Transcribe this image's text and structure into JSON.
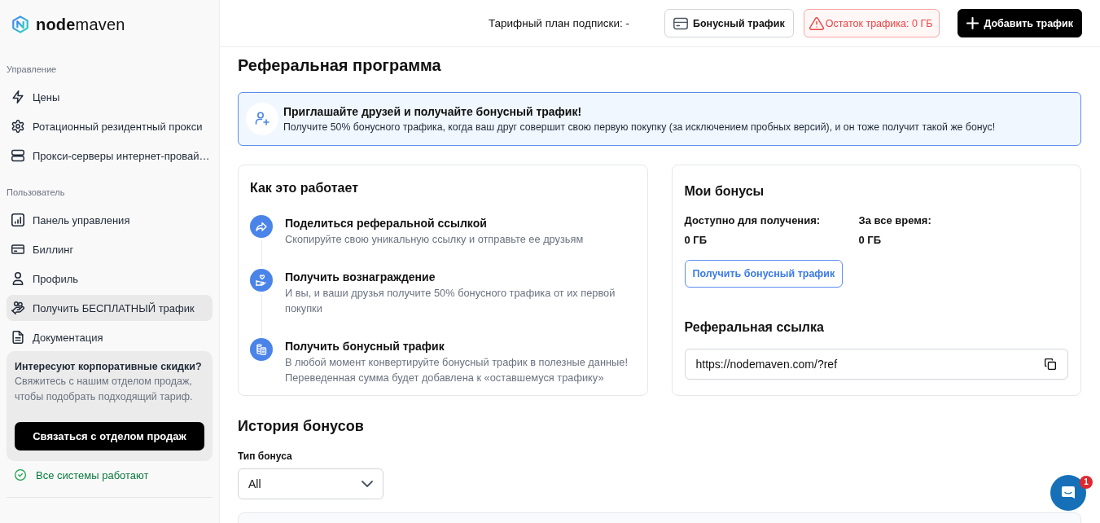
{
  "sidebar": {
    "logo": "**node**maven",
    "sections": [
      {
        "title": "Управление",
        "items": [
          {
            "label": "Цены",
            "selected": false
          },
          {
            "label": "Ротационный резидентный прокси",
            "selected": false
          },
          {
            "label": "Прокси-серверы интернет-провай…",
            "selected": false
          }
        ]
      },
      {
        "title": "Пользователь",
        "items": [
          {
            "label": "Панель управления",
            "selected": false
          },
          {
            "label": "Биллинг",
            "selected": false
          },
          {
            "label": "Профиль",
            "selected": false
          },
          {
            "label": "Получить БЕСПЛАТНЫЙ трафик",
            "selected": true
          },
          {
            "label": "Документация",
            "selected": false
          }
        ]
      }
    ],
    "promo": {
      "title": "Интересуют корпоративные скидки?",
      "text": "Свяжитесь с нашим отделом продаж, чтобы подобрать подходящий тариф.",
      "button": "Связаться с отделом продаж"
    },
    "status": {
      "label": "Все системы работают",
      "operational": true
    }
  },
  "header": {
    "plan": "Тарифный план подписки: -",
    "buttons": [
      {
        "label": "Бонусный трафик",
        "kind": "outline"
      },
      {
        "label": "Остаток трафика: 0 ГБ",
        "kind": "warning"
      },
      {
        "label": "Добавить трафик",
        "kind": "primary"
      }
    ]
  },
  "page_title": "Реферальная программа",
  "banner": {
    "title": "Приглашайте друзей и получайте бонусный трафик!",
    "text": "Получите 50% бонусного трафика, когда ваш друг совершит свою первую покупку (за исключением пробных версий), и он тоже получит такой же бонус!"
  },
  "how_it_works": {
    "title": "Как это работает",
    "steps": [
      {
        "title": "Поделиться реферальной ссылкой",
        "text": "Скопируйте свою уникальную ссылку и отправьте ее друзьям"
      },
      {
        "title": "Получить вознаграждение",
        "text": "И вы, и ваши друзья получите 50% бонусного трафика от их первой покупки"
      },
      {
        "title": "Получить бонусный трафик",
        "text": "В любой момент конвертируйте бонусный трафик в полезные данные! Переведенная сумма будет добавлена к «оставшемуся трафику»"
      }
    ]
  },
  "my_bonuses": {
    "title": "Мои бонусы",
    "stats": [
      {
        "label": "Доступно для получения:",
        "value": "0 ГБ"
      },
      {
        "label": "За все время:",
        "value": "0 ГБ"
      }
    ],
    "button": "Получить бонусный трафик",
    "link_title": "Реферальная ссылка",
    "link": "https://nodemaven.com/?ref"
  },
  "history": {
    "title": "История бонусов",
    "filter_label": "Тип бонуса",
    "filter_value": "All"
  },
  "chat": {
    "badge": "1"
  }
}
